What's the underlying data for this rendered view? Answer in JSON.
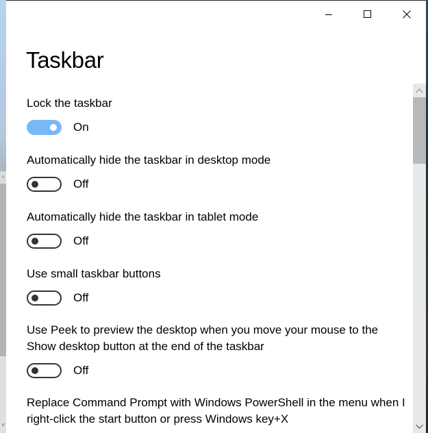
{
  "window": {
    "controls": {
      "minimize_icon": "minimize-icon",
      "maximize_icon": "maximize-icon",
      "close_icon": "close-icon"
    }
  },
  "page": {
    "title": "Taskbar"
  },
  "settings": [
    {
      "label": "Lock the taskbar",
      "state": "On",
      "checked": true
    },
    {
      "label": "Automatically hide the taskbar in desktop mode",
      "state": "Off",
      "checked": false
    },
    {
      "label": "Automatically hide the taskbar in tablet mode",
      "state": "Off",
      "checked": false
    },
    {
      "label": "Use small taskbar buttons",
      "state": "Off",
      "checked": false
    },
    {
      "label": "Use Peek to preview the desktop when you move your mouse to the Show desktop button at the end of the taskbar",
      "state": "Off",
      "checked": false
    },
    {
      "label": "Replace Command Prompt with Windows PowerShell in the menu when I right-click the start button or press Windows key+X"
    }
  ],
  "colors": {
    "toggle_on": "#76b9f5",
    "toggle_off_border": "#333333",
    "scroll_thumb": "#b9b9b9"
  }
}
